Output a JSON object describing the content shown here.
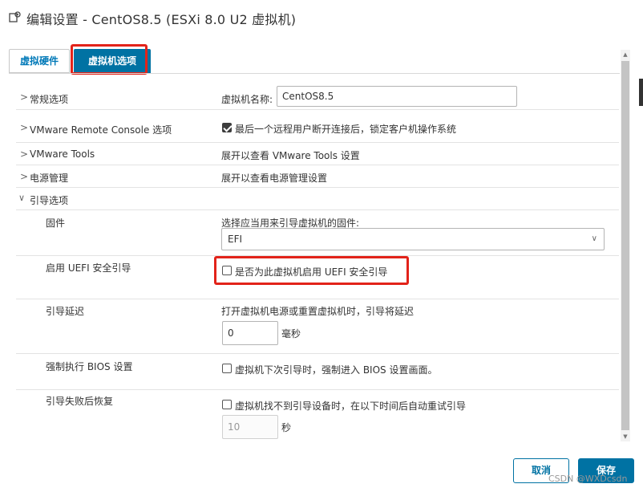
{
  "window": {
    "title": "编辑设置 - CentOS8.5 (ESXi 8.0 U2 虚拟机)"
  },
  "tabs": [
    {
      "label": "虚拟硬件",
      "active": false
    },
    {
      "label": "虚拟机选项",
      "active": true
    }
  ],
  "settings": {
    "general": {
      "label": "常规选项",
      "field_label": "虚拟机名称:",
      "vm_name": "CentOS8.5"
    },
    "vmrc": {
      "label": "VMware Remote Console 选项",
      "checked": true,
      "checkbox_label": "最后一个远程用户断开连接后，锁定客户机操作系统"
    },
    "vmtools": {
      "label": "VMware Tools",
      "value": "展开以查看 VMware Tools 设置"
    },
    "power": {
      "label": "电源管理",
      "value": "展开以查看电源管理设置"
    },
    "boot": {
      "label": "引导选项",
      "firmware": {
        "label": "固件",
        "desc": "选择应当用来引导虚拟机的固件:",
        "selected": "EFI"
      },
      "secure_boot": {
        "label": "启用 UEFI 安全引导",
        "checked": false,
        "checkbox_label": "是否为此虚拟机启用 UEFI 安全引导"
      },
      "boot_delay": {
        "label": "引导延迟",
        "desc": "打开虚拟机电源或重置虚拟机时，引导将延迟",
        "value": "0",
        "unit": "毫秒"
      },
      "force_bios": {
        "label": "强制执行 BIOS 设置",
        "checked": false,
        "checkbox_label": "虚拟机下次引导时，强制进入 BIOS 设置画面。"
      },
      "failed_boot": {
        "label": "引导失败后恢复",
        "checked": false,
        "checkbox_label": "虚拟机找不到引导设备时，在以下时间后自动重试引导",
        "value": "10",
        "unit": "秒"
      }
    }
  },
  "buttons": {
    "cancel": "取消",
    "save": "保存"
  },
  "watermark": "CSDN @WXDcsdn",
  "colors": {
    "accent": "#0072a3",
    "highlight": "#e2231a"
  }
}
